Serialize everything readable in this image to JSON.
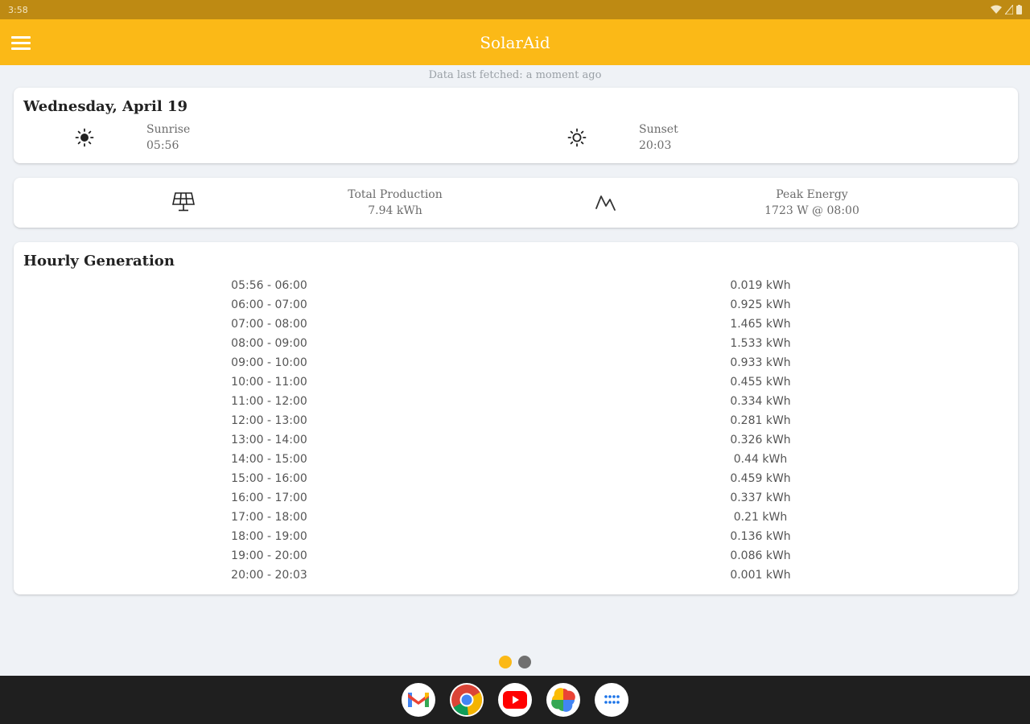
{
  "status_bar": {
    "time": "3:58"
  },
  "app_bar": {
    "title": "SolarAid"
  },
  "fetched_text": "Data last fetched: a moment ago",
  "sun_card": {
    "date": "Wednesday, April 19",
    "sunrise_label": "Sunrise",
    "sunrise_time": "05:56",
    "sunset_label": "Sunset",
    "sunset_time": "20:03"
  },
  "production_card": {
    "total_label": "Total Production",
    "total_value": "7.94 kWh",
    "peak_label": "Peak Energy",
    "peak_value": "1723 W @ 08:00"
  },
  "hourly": {
    "title": "Hourly Generation",
    "rows": [
      {
        "range": "05:56 - 06:00",
        "value": "0.019 kWh"
      },
      {
        "range": "06:00 - 07:00",
        "value": "0.925 kWh"
      },
      {
        "range": "07:00 - 08:00",
        "value": "1.465 kWh"
      },
      {
        "range": "08:00 - 09:00",
        "value": "1.533 kWh"
      },
      {
        "range": "09:00 - 10:00",
        "value": "0.933 kWh"
      },
      {
        "range": "10:00 - 11:00",
        "value": "0.455 kWh"
      },
      {
        "range": "11:00 - 12:00",
        "value": "0.334 kWh"
      },
      {
        "range": "12:00 - 13:00",
        "value": "0.281 kWh"
      },
      {
        "range": "13:00 - 14:00",
        "value": "0.326 kWh"
      },
      {
        "range": "14:00 - 15:00",
        "value": "0.44 kWh"
      },
      {
        "range": "15:00 - 16:00",
        "value": "0.459 kWh"
      },
      {
        "range": "16:00 - 17:00",
        "value": "0.337 kWh"
      },
      {
        "range": "17:00 - 18:00",
        "value": "0.21 kWh"
      },
      {
        "range": "18:00 - 19:00",
        "value": "0.136 kWh"
      },
      {
        "range": "19:00 - 20:00",
        "value": "0.086 kWh"
      },
      {
        "range": "20:00 - 20:03",
        "value": "0.001 kWh"
      }
    ]
  },
  "pager": {
    "active_page": 1,
    "page_count": 2
  },
  "colors": {
    "app_bar": "#fbb917",
    "status_bar": "#be8a13",
    "pager_active": "#fbb917",
    "pager_inactive": "#707070",
    "background": "#eff2f6"
  },
  "icons": {
    "menu": "hamburger-menu-icon",
    "sunrise": "sun-filled-icon",
    "sunset": "sun-outline-icon",
    "production": "solar-panel-icon",
    "peak": "peak-line-icon"
  },
  "dock": [
    "gmail-icon",
    "chrome-icon",
    "youtube-icon",
    "photos-icon",
    "app-drawer-icon"
  ]
}
